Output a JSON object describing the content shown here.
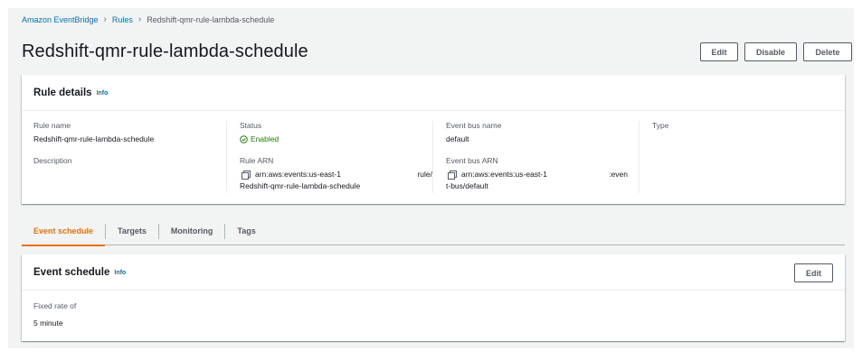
{
  "breadcrumb": {
    "root": "Amazon EventBridge",
    "rules": "Rules",
    "current": "Redshift-qmr-rule-lambda-schedule"
  },
  "page_title": "Redshift-qmr-rule-lambda-schedule",
  "actions": {
    "edit": "Edit",
    "disable": "Disable",
    "delete": "Delete"
  },
  "rule_details": {
    "title": "Rule details",
    "info": "Info",
    "rule_name_label": "Rule name",
    "rule_name": "Redshift-qmr-rule-lambda-schedule",
    "description_label": "Description",
    "status_label": "Status",
    "status": "Enabled",
    "rule_arn_label": "Rule ARN",
    "rule_arn_line1": "arn:aws:events:us-east-1",
    "rule_arn_tail": "rule/",
    "rule_arn_line2": "Redshift-qmr-rule-lambda-schedule",
    "event_bus_name_label": "Event bus name",
    "event_bus_name": "default",
    "event_bus_arn_label": "Event bus ARN",
    "event_bus_arn_line1": "arn:aws:events:us-east-1",
    "event_bus_arn_tail": ":even",
    "event_bus_arn_line2": "t-bus/default",
    "type_label": "Type"
  },
  "tabs": [
    {
      "label": "Event schedule",
      "active": true
    },
    {
      "label": "Targets"
    },
    {
      "label": "Monitoring"
    },
    {
      "label": "Tags"
    }
  ],
  "event_schedule": {
    "title": "Event schedule",
    "info": "Info",
    "edit": "Edit",
    "fixed_rate_label": "Fixed rate of",
    "fixed_rate_value": "5 minute"
  },
  "colors": {
    "link": "#0073bb",
    "active_tab": "#ec7211",
    "status_enabled": "#1d8102",
    "page_background": "#f2f3f3"
  },
  "icons": {
    "status": "check-circle-icon",
    "copy": "copy-icon",
    "breadcrumb_separator": "chevron-right-icon"
  }
}
